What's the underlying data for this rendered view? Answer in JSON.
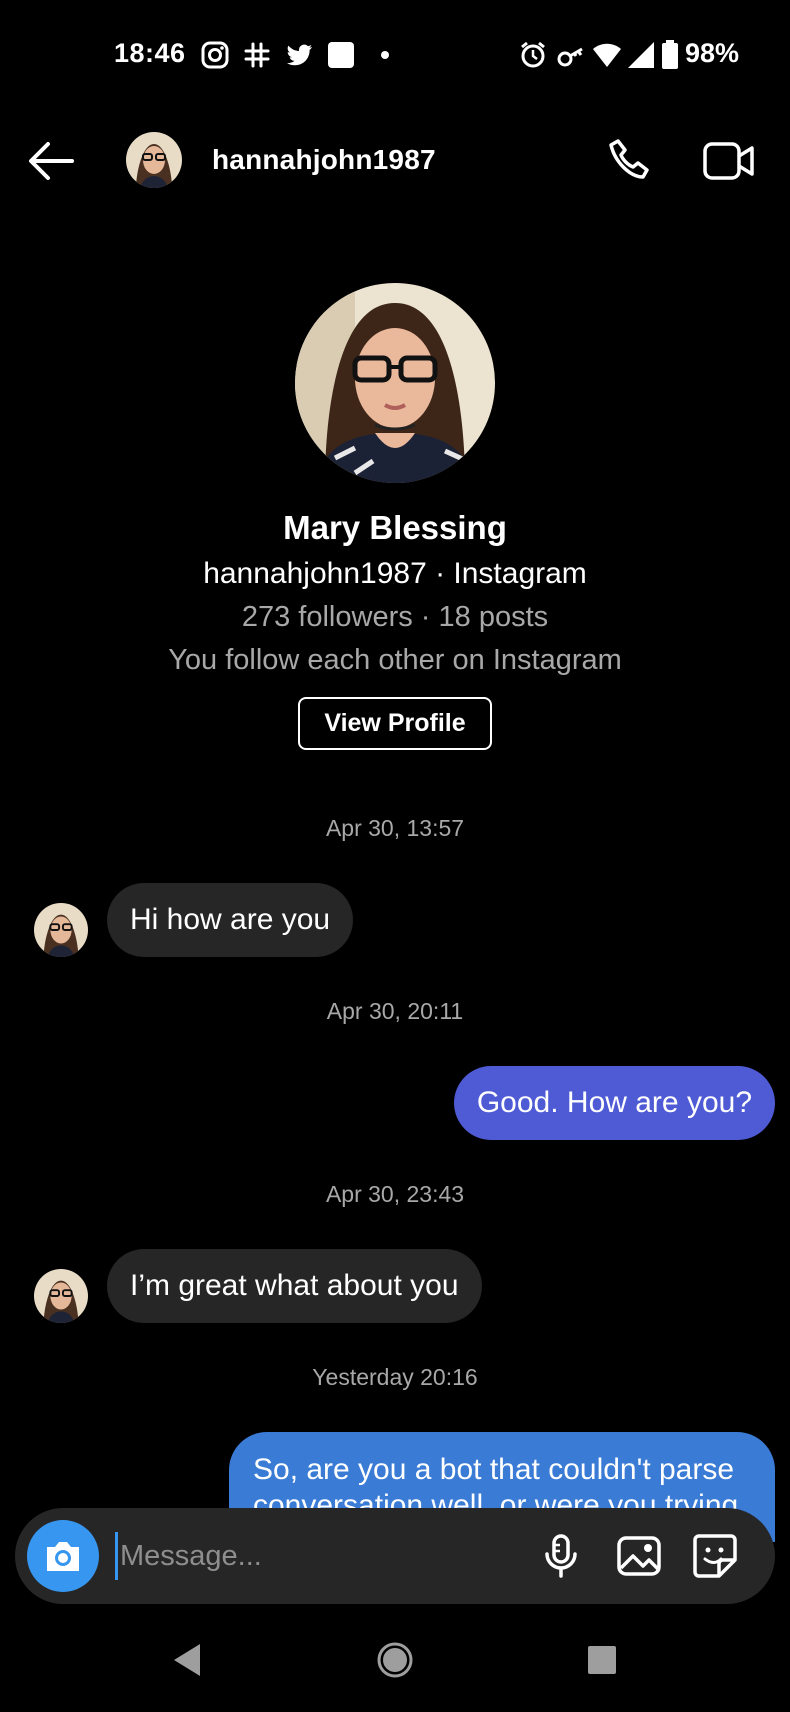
{
  "status_bar": {
    "time": "18:46",
    "battery": "98%",
    "icons": [
      "instagram-icon",
      "slack-icon",
      "twitter-icon",
      "square-icon",
      "dot-icon",
      "alarm-icon",
      "vpn-key-icon",
      "wifi-icon",
      "signal-icon",
      "battery-icon"
    ]
  },
  "header": {
    "username": "hannahjohn1987",
    "back_icon": "arrow-left-icon",
    "call_icon": "phone-icon",
    "video_icon": "video-camera-icon"
  },
  "profile": {
    "name": "Mary Blessing",
    "handle_line": "hannahjohn1987 · Instagram",
    "stats": "273 followers · 18 posts",
    "mutual": "You follow each other on Instagram",
    "view_profile_label": "View Profile"
  },
  "conversation": [
    {
      "timestamp": "Apr 30, 13:57"
    },
    {
      "from": "them",
      "text": "Hi how are you"
    },
    {
      "timestamp": "Apr 30, 20:11"
    },
    {
      "from": "me",
      "text": "Good. How are you?"
    },
    {
      "timestamp": "Apr 30, 23:43"
    },
    {
      "from": "them",
      "text": "I’m great what about you"
    },
    {
      "timestamp": "Yesterday 20:16"
    },
    {
      "from": "me",
      "text": "So, are you a bot that couldn't parse conversation well, or were you trying"
    }
  ],
  "composer": {
    "placeholder": "Message...",
    "value": "",
    "icons": [
      "camera-icon",
      "microphone-icon",
      "gallery-icon",
      "sticker-icon"
    ]
  },
  "colors": {
    "background": "#000000",
    "incoming_bubble": "#262626",
    "outgoing_bubble_purple": "#4f5bd5",
    "outgoing_bubble_blue": "#3a7bd5",
    "accent": "#3797f0",
    "secondary_text": "#a8a8a8"
  },
  "nav_bar": {
    "icons": [
      "nav-back-icon",
      "nav-home-icon",
      "nav-recents-icon"
    ]
  }
}
